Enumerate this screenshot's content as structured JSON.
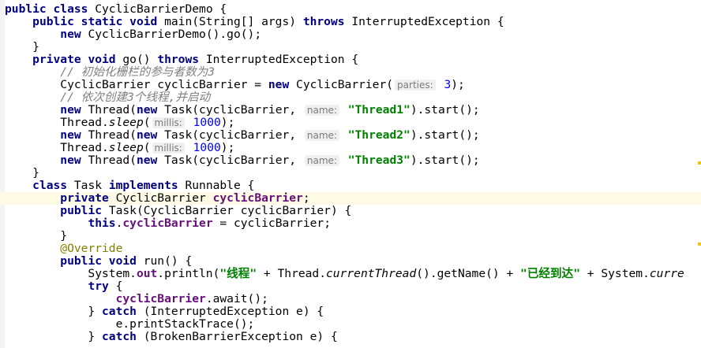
{
  "code_lines": [
    {
      "tokens": [
        [
          "kw",
          "public class "
        ],
        [
          "",
          "CyclicBarrierDemo {"
        ]
      ]
    },
    {
      "tokens": [
        [
          "",
          "    "
        ],
        [
          "kw",
          "public static void "
        ],
        [
          "",
          "main(String[] args) "
        ],
        [
          "kw",
          "throws "
        ],
        [
          "",
          "InterruptedException {"
        ]
      ]
    },
    {
      "tokens": [
        [
          "",
          "        "
        ],
        [
          "kw",
          "new "
        ],
        [
          "",
          "CyclicBarrierDemo().go();"
        ]
      ]
    },
    {
      "tokens": [
        [
          "",
          "    }"
        ]
      ]
    },
    {
      "tokens": [
        [
          "",
          "    "
        ],
        [
          "kw",
          "private void "
        ],
        [
          "",
          "go() "
        ],
        [
          "kw",
          "throws "
        ],
        [
          "",
          "InterruptedException {"
        ]
      ]
    },
    {
      "tokens": [
        [
          "",
          "        "
        ],
        [
          "cmt",
          "// 初始化栅栏的参与者数为3"
        ]
      ]
    },
    {
      "tokens": [
        [
          "",
          "        CyclicBarrier cyclicBarrier = "
        ],
        [
          "kw",
          "new "
        ],
        [
          "",
          "CyclicBarrier("
        ],
        [
          "hint",
          "parties:"
        ],
        [
          "num",
          " 3"
        ],
        [
          "",
          ");"
        ]
      ]
    },
    {
      "tokens": [
        [
          "",
          "        "
        ],
        [
          "cmt",
          "// 依次创建3个线程,并启动"
        ]
      ]
    },
    {
      "tokens": [
        [
          "",
          "        "
        ],
        [
          "kw",
          "new "
        ],
        [
          "",
          "Thread("
        ],
        [
          "kw",
          "new "
        ],
        [
          "",
          "Task(cyclicBarrier, "
        ],
        [
          "hint",
          "name:"
        ],
        [
          "str",
          " \"Thread1\""
        ],
        [
          "",
          ").start();"
        ]
      ]
    },
    {
      "tokens": [
        [
          "",
          "        Thread."
        ],
        [
          "it",
          "sleep"
        ],
        [
          "",
          "("
        ],
        [
          "hint",
          "millis:"
        ],
        [
          "num",
          " 1000"
        ],
        [
          "",
          ");"
        ]
      ]
    },
    {
      "tokens": [
        [
          "",
          "        "
        ],
        [
          "kw",
          "new "
        ],
        [
          "",
          "Thread("
        ],
        [
          "kw",
          "new "
        ],
        [
          "",
          "Task(cyclicBarrier, "
        ],
        [
          "hint",
          "name:"
        ],
        [
          "str",
          " \"Thread2\""
        ],
        [
          "",
          ").start();"
        ]
      ]
    },
    {
      "tokens": [
        [
          "",
          "        Thread."
        ],
        [
          "it",
          "sleep"
        ],
        [
          "",
          "("
        ],
        [
          "hint",
          "millis:"
        ],
        [
          "num",
          " 1000"
        ],
        [
          "",
          ");"
        ]
      ]
    },
    {
      "tokens": [
        [
          "",
          "        "
        ],
        [
          "kw",
          "new "
        ],
        [
          "",
          "Thread("
        ],
        [
          "kw",
          "new "
        ],
        [
          "",
          "Task(cyclicBarrier, "
        ],
        [
          "hint",
          "name:"
        ],
        [
          "str",
          " \"Thread3\""
        ],
        [
          "",
          ").start();"
        ]
      ]
    },
    {
      "tokens": [
        [
          "",
          "    }"
        ]
      ]
    },
    {
      "tokens": [
        [
          "",
          "    "
        ],
        [
          "kw",
          "class "
        ],
        [
          "",
          "Task "
        ],
        [
          "kw",
          "implements "
        ],
        [
          "",
          "Runnable {"
        ]
      ]
    },
    {
      "highlight": true,
      "tokens": [
        [
          "",
          "        "
        ],
        [
          "kw",
          "private "
        ],
        [
          "",
          "CyclicBarrier "
        ],
        [
          "field",
          "cyclicBarrier"
        ],
        [
          "",
          ";"
        ]
      ]
    },
    {
      "tokens": [
        [
          "",
          "        "
        ],
        [
          "kw",
          "public "
        ],
        [
          "",
          "Task(CyclicBarrier cyclicBarrier) {"
        ]
      ]
    },
    {
      "tokens": [
        [
          "",
          "            "
        ],
        [
          "kw",
          "this"
        ],
        [
          "",
          "."
        ],
        [
          "field",
          "cyclicBarrier "
        ],
        [
          "",
          "= cyclicBarrier;"
        ]
      ]
    },
    {
      "tokens": [
        [
          "",
          "        }"
        ]
      ]
    },
    {
      "tokens": [
        [
          "",
          "        "
        ],
        [
          "ann",
          "@Override"
        ]
      ]
    },
    {
      "tokens": [
        [
          "",
          "        "
        ],
        [
          "kw",
          "public void "
        ],
        [
          "",
          "run() {"
        ]
      ]
    },
    {
      "tokens": [
        [
          "",
          "            System."
        ],
        [
          "field",
          "out"
        ],
        [
          "",
          ".println("
        ],
        [
          "str",
          "\"线程\""
        ],
        [
          "",
          " + Thread."
        ],
        [
          "it",
          "currentThread"
        ],
        [
          "",
          "().getName() + "
        ],
        [
          "str",
          "\"已经到达\""
        ],
        [
          "",
          " + System."
        ],
        [
          "it",
          "curre"
        ]
      ]
    },
    {
      "tokens": [
        [
          "",
          "            "
        ],
        [
          "kw",
          "try "
        ],
        [
          "",
          "{"
        ]
      ]
    },
    {
      "tokens": [
        [
          "",
          "                "
        ],
        [
          "field",
          "cyclicBarrier"
        ],
        [
          "",
          ".await();"
        ]
      ]
    },
    {
      "tokens": [
        [
          "",
          "            } "
        ],
        [
          "kw",
          "catch "
        ],
        [
          "",
          "(InterruptedException e) {"
        ]
      ]
    },
    {
      "tokens": [
        [
          "",
          "                e.printStackTrace();"
        ]
      ]
    },
    {
      "tokens": [
        [
          "",
          "            } "
        ],
        [
          "kw",
          "catch "
        ],
        [
          "",
          "(BrokenBarrierException e) {"
        ]
      ]
    }
  ]
}
